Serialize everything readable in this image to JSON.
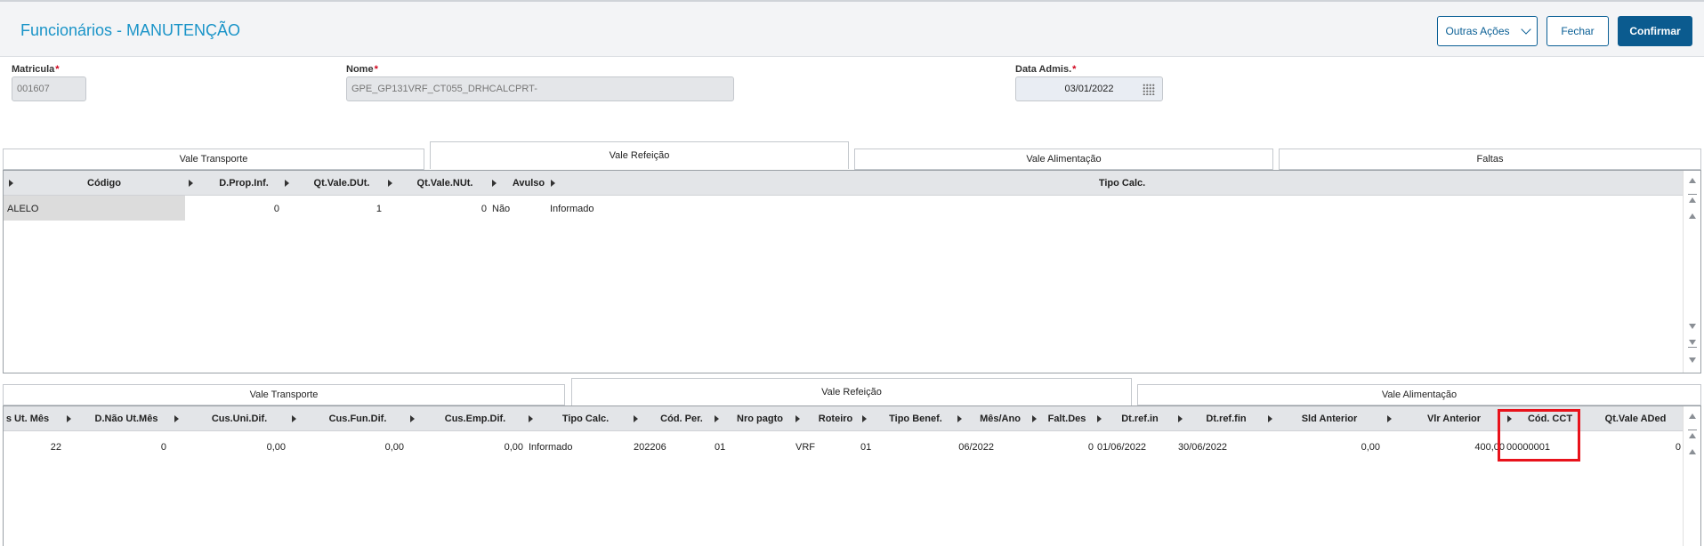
{
  "header": {
    "title": "Funcionários - MANUTENÇÃO",
    "outras_acoes": "Outras Ações",
    "fechar": "Fechar",
    "confirmar": "Confirmar"
  },
  "fields": {
    "matricula_label": "Matricula",
    "matricula_value": "001607",
    "nome_label": "Nome",
    "nome_value": "GPE_GP131VRF_CT055_DRHCALCPRT-",
    "data_admis_label": "Data Admis.",
    "data_admis_value": "03/01/2022",
    "required_mark": "*"
  },
  "top_tabs": [
    "Vale Transporte",
    "Vale Refeição",
    "Vale Alimentação",
    "Faltas"
  ],
  "top_grid": {
    "headers": [
      "Código",
      "D.Prop.Inf.",
      "Qt.Vale.DUt.",
      "Qt.Vale.NUt.",
      "Avulso",
      "Tipo Calc."
    ],
    "rows": [
      {
        "codigo": "ALELO",
        "dprop": "0",
        "qtdut": "1",
        "qtnut": "0",
        "avulso": "Não",
        "tipo": "Informado"
      }
    ]
  },
  "bottom_tabs": [
    "Vale Transporte",
    "Vale Refeição",
    "Vale Alimentação"
  ],
  "bottom_grid": {
    "headers": [
      "s Ut. Mês",
      "D.Não Ut.Mês",
      "Cus.Uni.Dif.",
      "Cus.Fun.Dif.",
      "Cus.Emp.Dif.",
      "Tipo Calc.",
      "Cód. Per.",
      "Nro pagto",
      "Roteiro",
      "Tipo Benef.",
      "Mês/Ano",
      "Falt.Des",
      "Dt.ref.in",
      "Dt.ref.fin",
      "Sld Anterior",
      "Vlr Anterior",
      "Cód. CCT",
      "Qt.Vale ADed"
    ],
    "row": {
      "ut_mes": "22",
      "nao_ut_mes": "0",
      "cus_uni": "0,00",
      "cus_fun": "0,00",
      "cus_emp": "0,00",
      "tipo_calc": "Informado",
      "cod_per": "202206",
      "nro_pagto": "01",
      "roteiro": "VRF",
      "tipo_benef": "01",
      "mes_ano": "06/2022",
      "falt_des": "0",
      "dt_ini": "01/06/2022",
      "dt_fin": "30/06/2022",
      "sld_ant": "0,00",
      "vlr_ant": "400,00",
      "cod_cct": "00000001",
      "qt_vale_aded": "0"
    }
  },
  "colors": {
    "accent": "#1a94c8",
    "primary": "#0b5b8f",
    "highlight": "#e8121b"
  }
}
